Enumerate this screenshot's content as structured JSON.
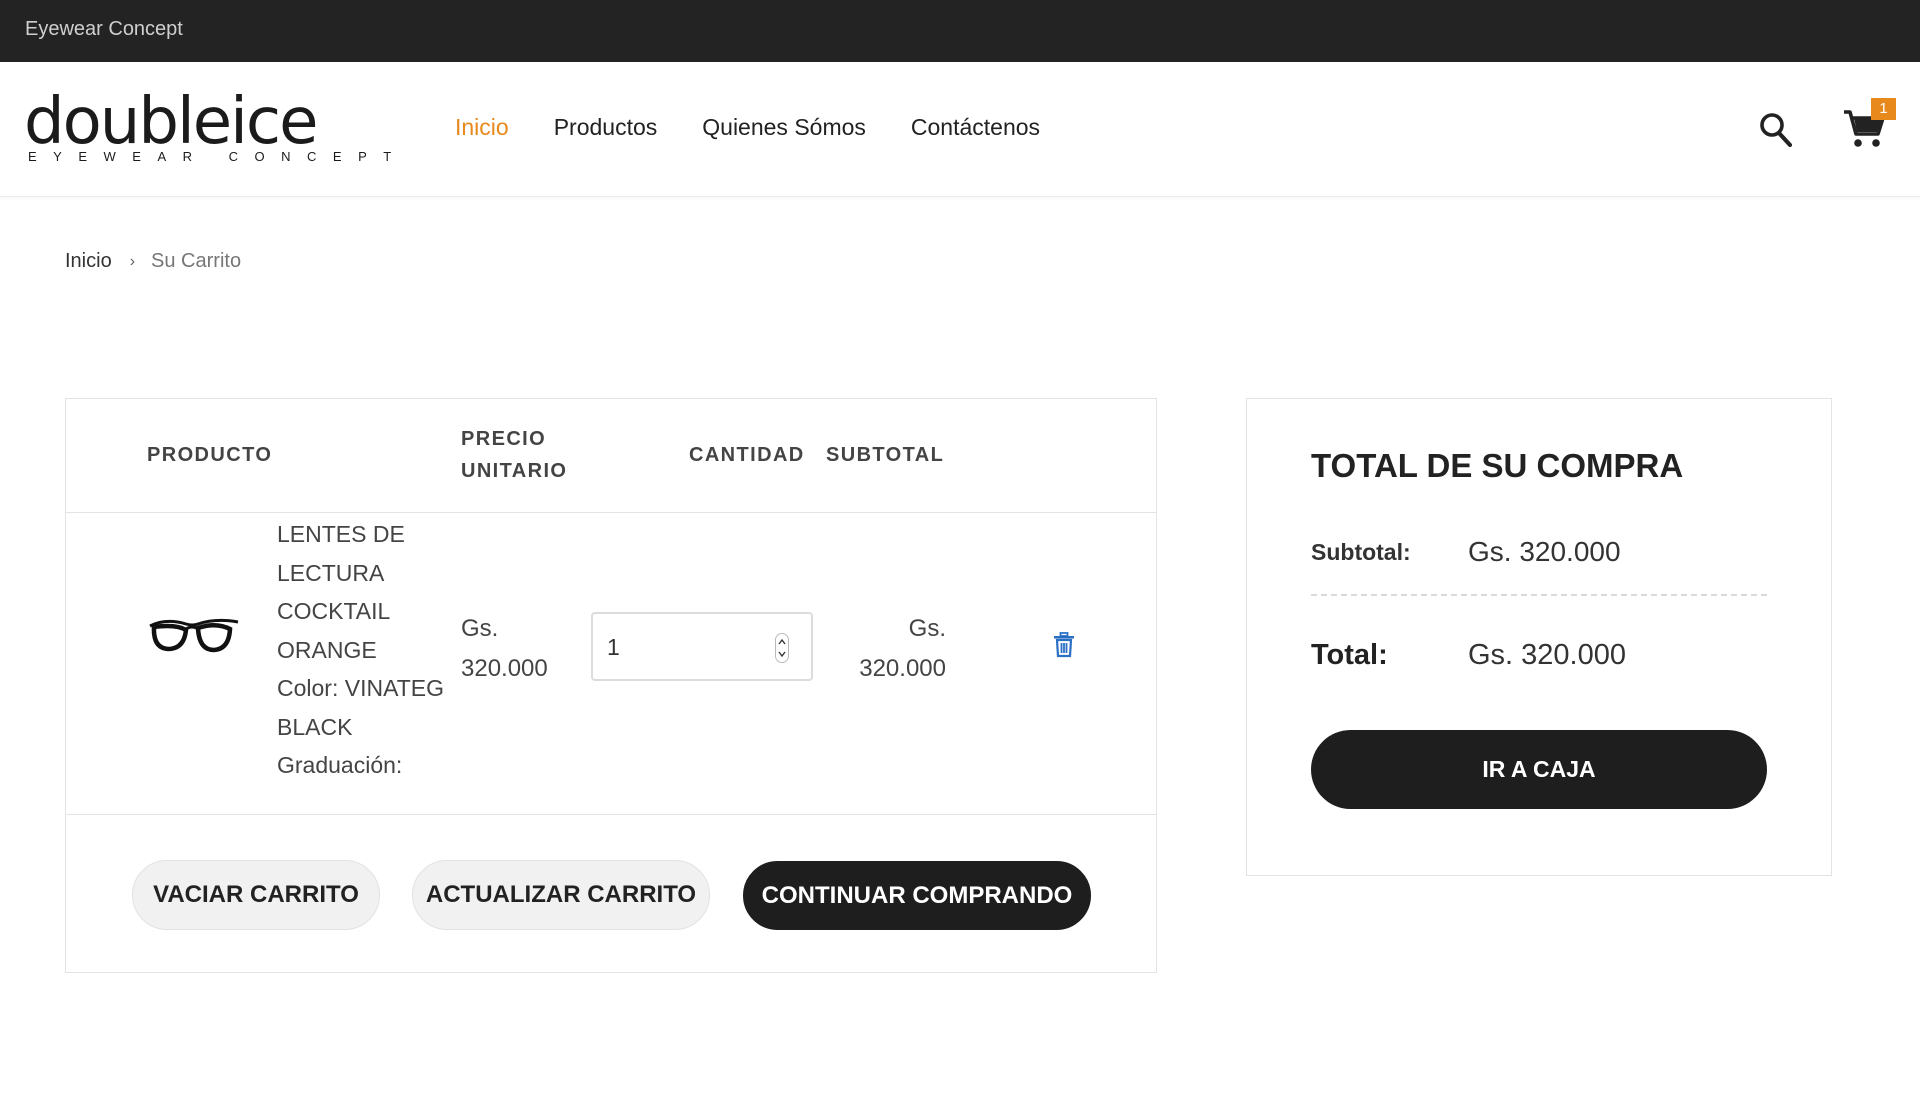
{
  "topbar": {
    "text": "Eyewear Concept"
  },
  "logo": {
    "word": "doubleice",
    "tagline": "EYEWEAR CONCEPT"
  },
  "nav": {
    "items": [
      {
        "label": "Inicio",
        "active": true
      },
      {
        "label": "Productos",
        "active": false
      },
      {
        "label": "Quienes Sómos",
        "active": false
      },
      {
        "label": "Contáctenos",
        "active": false
      }
    ]
  },
  "header_icons": {
    "search": "search-icon",
    "cart": "cart-icon",
    "cart_count": "1"
  },
  "breadcrumb": {
    "home": "Inicio",
    "separator": "›",
    "current": "Su Carrito"
  },
  "cart_table": {
    "headers": {
      "product": "PRODUCTO",
      "unit_price_1": "PRECIO",
      "unit_price_2": "UNITARIO",
      "quantity": "CANTIDAD",
      "subtotal": "SUBTOTAL"
    },
    "items": [
      {
        "name_lines": [
          "LENTES DE",
          "LECTURA",
          "COCKTAIL",
          "ORANGE",
          "Color: VINATEG",
          "BLACK",
          "Graduación:"
        ],
        "unit_price_lines": [
          "Gs.",
          "320.000"
        ],
        "quantity": "1",
        "subtotal_lines": [
          "Gs.",
          "320.000"
        ],
        "remove_icon": "trash-icon",
        "image_icon": "glasses-icon"
      }
    ],
    "buttons": {
      "clear": "VACIAR CARRITO",
      "update": "ACTUALIZAR CARRITO",
      "continue": "CONTINUAR COMPRANDO"
    }
  },
  "summary": {
    "title": "TOTAL DE SU COMPRA",
    "subtotal_label": "Subtotal:",
    "subtotal_value": "Gs. 320.000",
    "total_label": "Total:",
    "total_value": "Gs. 320.000",
    "checkout_label": "IR A CAJA"
  },
  "colors": {
    "accent": "#e8891c",
    "dark": "#1e1e1e",
    "topbar": "#232323",
    "trash": "#2b6fc4"
  }
}
